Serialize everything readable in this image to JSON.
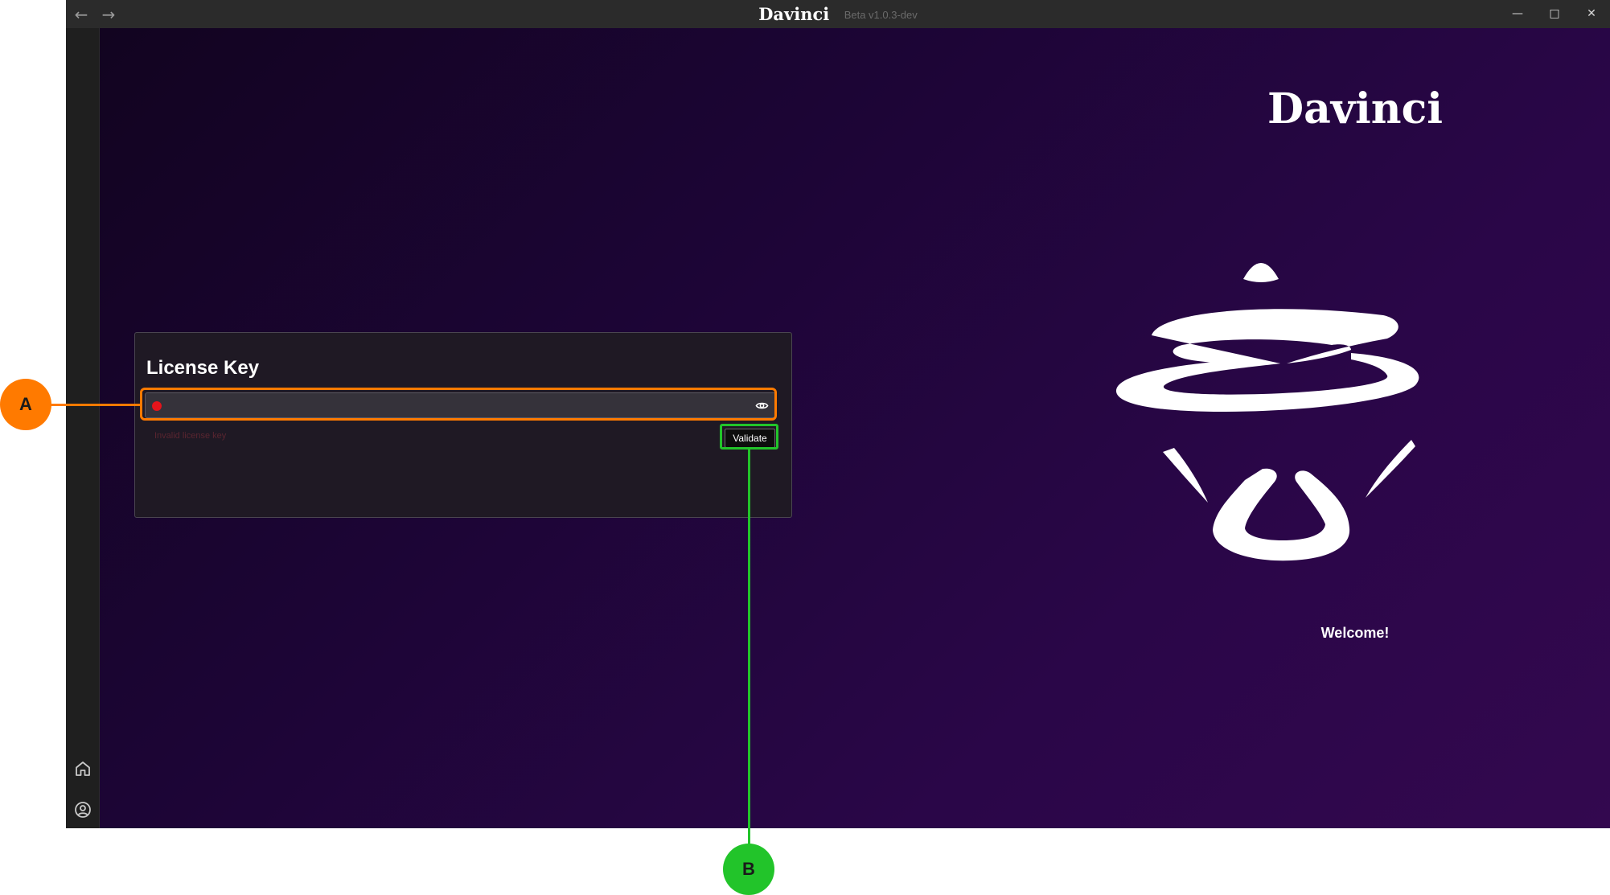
{
  "window": {
    "title": "Davinci",
    "version": "Beta v1.0.3-dev",
    "back_icon": "arrow-left-icon",
    "forward_icon": "arrow-right-icon",
    "minimize_icon": "minimize-icon",
    "maximize_icon": "maximize-icon",
    "close_icon": "close-icon"
  },
  "sidebar": {
    "items": [
      {
        "icon": "home-icon"
      },
      {
        "icon": "user-circle-icon"
      }
    ]
  },
  "license": {
    "title": "License Key",
    "value": "",
    "placeholder": "",
    "error": "Invalid license key",
    "validate_label": "Validate",
    "status_color": "#e5141b"
  },
  "hero": {
    "brand": "Davinci",
    "welcome": "Welcome!"
  },
  "annotations": {
    "a": "A",
    "b": "B",
    "a_color": "#ff7a00",
    "b_color": "#22c42a"
  },
  "colors": {
    "background_start": "#120420",
    "background_end": "#33084f",
    "card": "#1f1924",
    "titlebar": "#2b2b2b"
  }
}
